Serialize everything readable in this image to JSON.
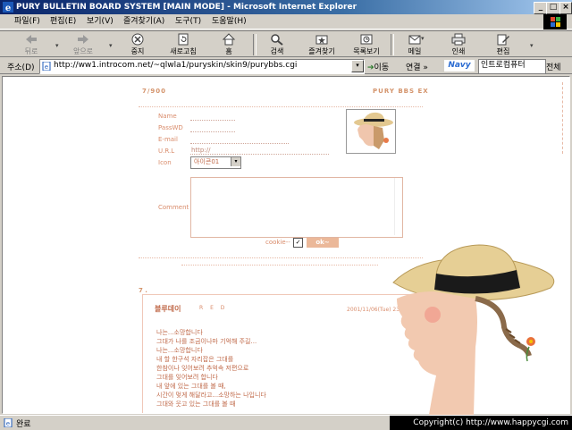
{
  "window": {
    "title": "PURY BULLETIN BOARD SYSTEM [MAIN MODE] - Microsoft Internet Explorer",
    "minimize": "_",
    "maximize": "□",
    "close": "×"
  },
  "menu": [
    "파일(F)",
    "편집(E)",
    "보기(V)",
    "즐겨찾기(A)",
    "도구(T)",
    "도움말(H)"
  ],
  "toolbar": {
    "back": "뒤로",
    "forward": "앞으로",
    "stop": "중지",
    "refresh": "새로고침",
    "home": "홈",
    "search": "검색",
    "favorites": "즐겨찾기",
    "history": "목록보기",
    "mail": "메일",
    "print": "인쇄",
    "edit": "편집",
    "dropdown": "▾"
  },
  "address": {
    "label": "주소(D)",
    "url": "http://ww1.introcom.net/~qlwla1/puryskin/skin9/purybbs.cgi",
    "go": "이동",
    "links": "연결 »",
    "navy_logo": "Navy",
    "navy_value": "인트로컴퓨터",
    "navy_all": "전체"
  },
  "page": {
    "counter": "7/900",
    "brand": "PURY BBS EX",
    "form": {
      "name_label": "Name",
      "password_label": "PassWD",
      "email_label": "E-mail",
      "url_label": "U.R.L",
      "url_value": "http://",
      "icon_label": "Icon",
      "icon_value": "아이콘01",
      "comment_label": "Comment",
      "cookie_label": "cookie--",
      "cookie_check": "✓",
      "ok_label": "ok~"
    },
    "post": {
      "number": "7 .",
      "author": "블루데이",
      "tag": "R E D",
      "date": "2001/11/06(Tue) 23:2",
      "lines": [
        "나는...소망합니다",
        "그대가 나를 조금이나마 기억해 주길...",
        "나는...소망합니다",
        "내 할 한구석 자리잡은 그대를",
        "한참이나 잊어보려 추억속 저편으로",
        "그대를 잊어보려 합니다",
        "내 앞에 있는 그대를 볼 때,",
        "시간이 멎게 해달라고...소망하는 나입니다",
        "그대와 웃고 있는 그대를 볼 때"
      ]
    }
  },
  "status": {
    "text": "완료",
    "copyright": "Copyright(c) http://www.happycgi.com"
  }
}
